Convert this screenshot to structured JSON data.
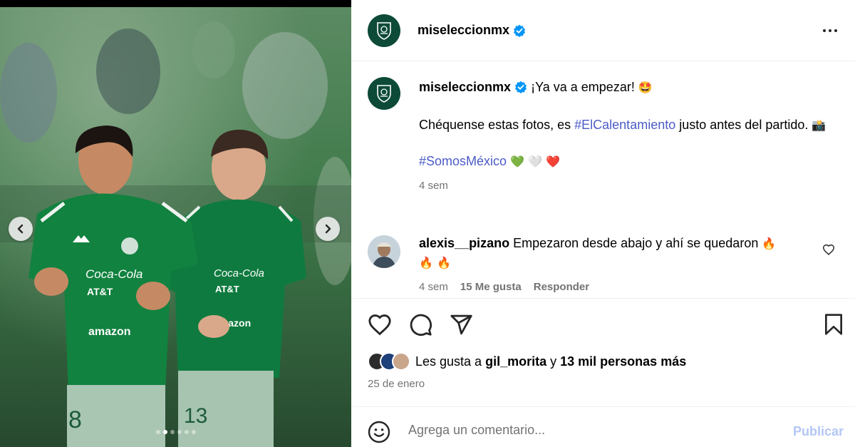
{
  "post": {
    "username": "miseleccionmx",
    "carousel_slides": 6,
    "carousel_active_index": 1
  },
  "caption": {
    "username": "miseleccionmx",
    "line1_text": "¡Ya va a empezar!",
    "line1_emoji": "🤩",
    "line2_before": "Chéquense estas fotos, es ",
    "line2_hashtag": "#ElCalentamiento",
    "line2_after": " justo antes del partido.",
    "line2_emoji": "📸",
    "hashtag2": "#SomosMéxico",
    "hearts": [
      "💚",
      "🤍",
      "❤️"
    ],
    "age": "4 sem"
  },
  "comment": {
    "username": "alexis__pizano",
    "text": "Empezaron desde abajo y ahí se quedaron",
    "fire": "🔥",
    "age": "4 sem",
    "likes": "15 Me gusta",
    "reply": "Responder"
  },
  "likes": {
    "prefix": "Les gusta a ",
    "user": "gil_morita",
    "connector": " y ",
    "others": "13 mil personas más"
  },
  "date": "25 de enero",
  "comment_box": {
    "placeholder": "Agrega un comentario...",
    "post_label": "Publicar"
  },
  "colors": {
    "accent_link": "#4b5bc7",
    "verified": "#0095f6",
    "publish_disabled": "#b3c7f5",
    "brand_green": "#0d4a38"
  },
  "icons": [
    "chevron-left-icon",
    "chevron-right-icon",
    "more-icon",
    "verified-icon",
    "heart-icon",
    "comment-icon",
    "share-icon",
    "bookmark-icon",
    "emoji-icon"
  ]
}
